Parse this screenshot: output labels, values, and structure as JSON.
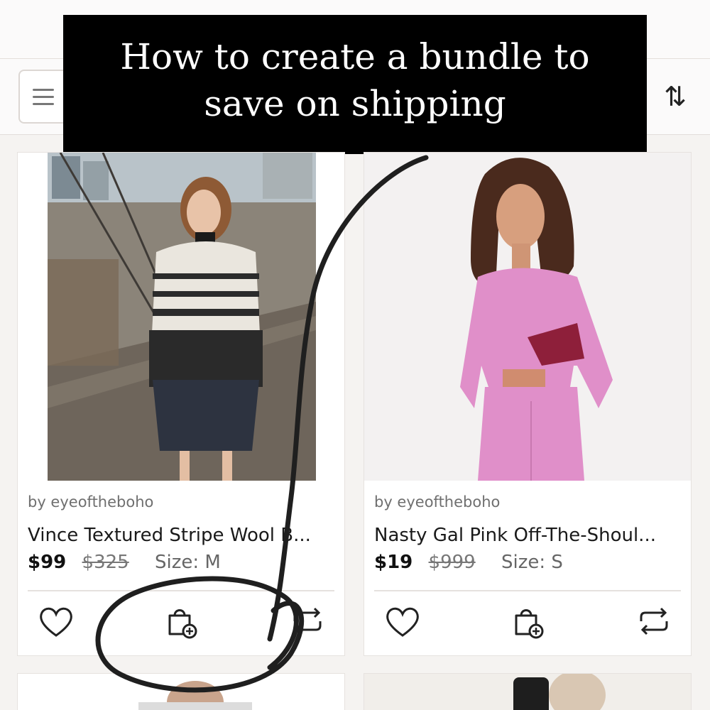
{
  "banner": {
    "line1": "How to create a bundle to",
    "line2": "save on shipping"
  },
  "header": {
    "menu_icon": "hamburger-icon",
    "sort_icon": "sort-arrows-icon",
    "sort_glyph": "⇅"
  },
  "products": [
    {
      "seller": "by eyeoftheboho",
      "title": "Vince Textured Stripe Wool B...",
      "price": "$99",
      "original_price": "$325",
      "size": "Size: M",
      "actions": [
        "heart-icon",
        "bundle-bag-add-icon",
        "share-repost-icon"
      ]
    },
    {
      "seller": "by eyeoftheboho",
      "title": "Nasty Gal Pink Off-The-Shoul...",
      "price": "$19",
      "original_price": "$999",
      "size": "Size: S",
      "actions": [
        "heart-icon",
        "bundle-bag-add-icon",
        "share-repost-icon"
      ]
    }
  ],
  "colors": {
    "accent_pink": "#e08fc9",
    "banner_bg": "#000000",
    "scribble": "#1f1f1f"
  }
}
